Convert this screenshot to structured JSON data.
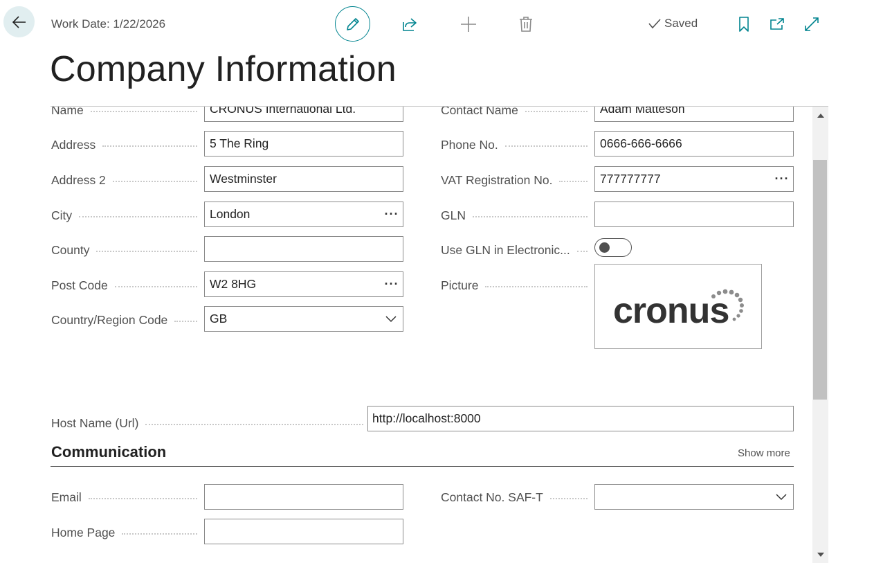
{
  "header": {
    "work_date": "Work Date: 1/22/2026",
    "saved_label": "Saved",
    "title": "Company Information"
  },
  "general": {
    "left_fields": [
      {
        "label": "Name",
        "value": "CRONUS International Ltd.",
        "type": "text"
      },
      {
        "label": "Address",
        "value": "5 The Ring",
        "type": "text"
      },
      {
        "label": "Address 2",
        "value": "Westminster",
        "type": "text"
      },
      {
        "label": "City",
        "value": "London",
        "type": "lookup"
      },
      {
        "label": "County",
        "value": "",
        "type": "text"
      },
      {
        "label": "Post Code",
        "value": "W2 8HG",
        "type": "lookup"
      },
      {
        "label": "Country/Region Code",
        "value": "GB",
        "type": "dropdown"
      }
    ],
    "right_fields": [
      {
        "label": "Contact Name",
        "value": "Adam Matteson",
        "type": "text"
      },
      {
        "label": "Phone No.",
        "value": "0666-666-6666",
        "type": "text"
      },
      {
        "label": "VAT Registration No.",
        "value": "777777777",
        "type": "lookup"
      },
      {
        "label": "GLN",
        "value": "",
        "type": "text"
      },
      {
        "label": "Use GLN in Electronic...",
        "value": false,
        "type": "toggle"
      },
      {
        "label": "Picture",
        "value": "cronus",
        "type": "picture"
      }
    ],
    "host_name_label": "Host Name (Url)",
    "host_name_value": "http://localhost:8000"
  },
  "communication": {
    "title": "Communication",
    "show_more": "Show more",
    "email_label": "Email",
    "email_value": "",
    "home_page_label": "Home Page",
    "home_page_value": "",
    "contact_saft_label": "Contact No. SAF-T",
    "contact_saft_value": ""
  },
  "icons": {
    "back": "arrow-left-icon",
    "edit": "pencil-icon",
    "share": "share-icon",
    "new": "plus-icon",
    "delete": "trash-icon",
    "saved": "checkmark-icon",
    "bookmark": "bookmark-icon",
    "open_new": "open-in-new-window-icon",
    "expand": "expand-icon"
  },
  "colors": {
    "accent": "#00848f",
    "back_button_bg": "#e1eef0"
  }
}
